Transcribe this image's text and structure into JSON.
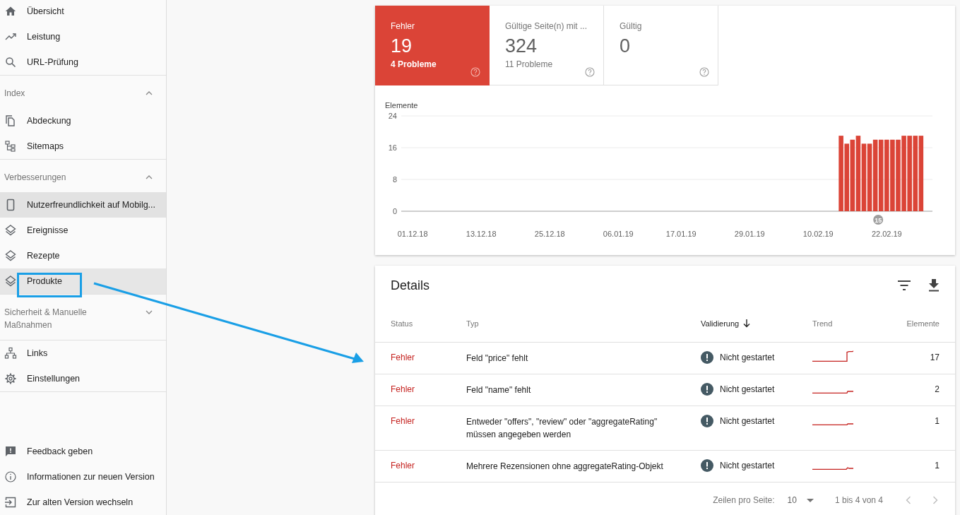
{
  "sidebar": {
    "groups": [
      {
        "items": [
          {
            "label": "Übersicht",
            "selected": false
          },
          {
            "label": "Leistung",
            "selected": false
          },
          {
            "label": "URL-Prüfung",
            "selected": false
          }
        ]
      },
      {
        "title": "Index",
        "expanded": true,
        "items": [
          {
            "label": "Abdeckung",
            "selected": false
          },
          {
            "label": "Sitemaps",
            "selected": false
          }
        ]
      },
      {
        "title": "Verbesserungen",
        "expanded": true,
        "items": [
          {
            "label": "Nutzerfreundlichkeit auf Mobilg...",
            "selected": true,
            "hovered": false
          },
          {
            "label": "Ereignisse",
            "selected": false,
            "hovered": false
          },
          {
            "label": "Rezepte",
            "selected": false,
            "hovered": false
          },
          {
            "label": "Produkte",
            "selected": false,
            "hovered": true
          }
        ]
      },
      {
        "title": "Sicherheit & Manuelle Maßnahmen",
        "expanded": false
      },
      {
        "items": [
          {
            "label": "Links",
            "selected": false
          },
          {
            "label": "Einstellungen",
            "selected": false
          }
        ]
      }
    ],
    "footer_items": [
      {
        "label": "Feedback geben"
      },
      {
        "label": "Informationen zur neuen Version"
      },
      {
        "label": "Zur alten Version wechseln"
      }
    ]
  },
  "summary_tiles": [
    {
      "label": "Fehler",
      "value": "19",
      "subtitle": "4 Probleme",
      "selected": true
    },
    {
      "label": "Gültige Seite(n) mit ...",
      "value": "324",
      "subtitle": "11 Probleme",
      "selected": false
    },
    {
      "label": "Gültig",
      "value": "0",
      "selected": false
    }
  ],
  "chart_data": {
    "type": "bar",
    "ylabel": "Elemente",
    "categories": [
      "01.12.18",
      null,
      null,
      null,
      null,
      null,
      null,
      null,
      null,
      null,
      null,
      null,
      "13.12.18",
      null,
      null,
      null,
      null,
      null,
      null,
      null,
      null,
      null,
      null,
      null,
      "25.12.18",
      null,
      null,
      null,
      null,
      null,
      null,
      null,
      null,
      null,
      null,
      null,
      "06.01.19",
      null,
      null,
      null,
      null,
      null,
      null,
      null,
      null,
      null,
      null,
      "17.01.19",
      null,
      null,
      null,
      null,
      null,
      null,
      null,
      null,
      null,
      null,
      null,
      "29.01.19",
      null,
      null,
      null,
      null,
      null,
      null,
      null,
      null,
      null,
      null,
      null,
      "10.02.19",
      null,
      null,
      null,
      null,
      null,
      null,
      null,
      null,
      null,
      null,
      null,
      "22.02.19",
      null,
      null,
      null,
      null,
      null,
      null
    ],
    "values": [
      null,
      null,
      null,
      null,
      null,
      null,
      null,
      null,
      null,
      null,
      null,
      null,
      null,
      null,
      null,
      null,
      null,
      null,
      null,
      null,
      null,
      null,
      null,
      null,
      null,
      null,
      null,
      null,
      null,
      null,
      null,
      null,
      null,
      null,
      null,
      null,
      null,
      null,
      null,
      null,
      null,
      null,
      null,
      null,
      null,
      null,
      null,
      null,
      null,
      null,
      null,
      null,
      null,
      null,
      null,
      null,
      null,
      null,
      null,
      null,
      null,
      null,
      null,
      null,
      null,
      null,
      null,
      null,
      null,
      null,
      null,
      null,
      null,
      null,
      null,
      19,
      17,
      18,
      19,
      17,
      17,
      18,
      18,
      18,
      18,
      18,
      19,
      19,
      19,
      19
    ],
    "ylim": [
      0,
      24
    ],
    "yticks": [
      0,
      8,
      16,
      24
    ],
    "annotations": [
      "15"
    ]
  },
  "details": {
    "title": "Details",
    "columns": [
      {
        "label": "Status",
        "sorted": false
      },
      {
        "label": "Typ",
        "sorted": false
      },
      {
        "label": "Validierung",
        "sorted": true
      },
      {
        "label": "Trend",
        "sorted": false
      },
      {
        "label": "Elemente",
        "sorted": false
      }
    ],
    "rows": [
      {
        "status": "Fehler",
        "type": "Feld \"price\" fehlt",
        "validation": "Nicht gestartet",
        "elements": "17"
      },
      {
        "status": "Fehler",
        "type": "Feld \"name\" fehlt",
        "validation": "Nicht gestartet",
        "elements": "2"
      },
      {
        "status": "Fehler",
        "type": "Entweder \"offers\", \"review\" oder \"aggregateRating\" müssen angegeben werden",
        "validation": "Nicht gestartet",
        "elements": "1"
      },
      {
        "status": "Fehler",
        "type": "Mehrere Rezensionen ohne aggregateRating-Objekt",
        "validation": "Nicht gestartet",
        "elements": "1"
      }
    ],
    "pagination": {
      "rows_label": "Zeilen pro Seite:",
      "rows_value": "10",
      "range": "1 bis 4 von 4"
    }
  }
}
